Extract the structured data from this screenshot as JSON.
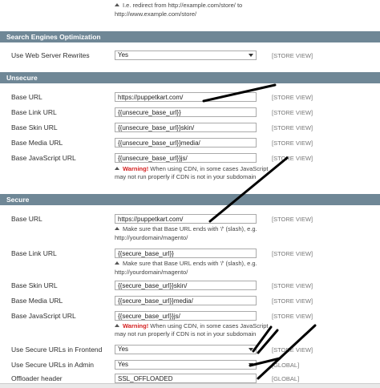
{
  "top_note": {
    "line1": "I.e. redirect from http://example.com/store/ to",
    "line2": "http://www.example.com/store/"
  },
  "seo": {
    "title": "Search Engines Optimization",
    "rewrites_label": "Use Web Server Rewrites",
    "rewrites_value": "Yes",
    "rewrites_scope": "[STORE VIEW]"
  },
  "unsecure": {
    "title": "Unsecure",
    "base_url_label": "Base URL",
    "base_url_value": "https://puppetkart.com/",
    "base_url_scope": "[STORE VIEW]",
    "base_link_label": "Base Link URL",
    "base_link_value": "{{unsecure_base_url}}",
    "base_link_scope": "[STORE VIEW]",
    "base_skin_label": "Base Skin URL",
    "base_skin_value": "{{unsecure_base_url}}skin/",
    "base_skin_scope": "[STORE VIEW]",
    "base_media_label": "Base Media URL",
    "base_media_value": "{{unsecure_base_url}}media/",
    "base_media_scope": "[STORE VIEW]",
    "base_js_label": "Base JavaScript URL",
    "base_js_value": "{{unsecure_base_url}}js/",
    "base_js_scope": "[STORE VIEW]",
    "warning_word": "Warning!",
    "warning_line1": " When using CDN, in some cases JavaScript",
    "warning_line2": "may not run properly if CDN is not in your subdomain"
  },
  "secure": {
    "title": "Secure",
    "base_url_label": "Base URL",
    "base_url_value": "https://puppetkart.com/",
    "base_url_scope": "[STORE VIEW]",
    "base_url_note1": "Make sure that Base URL ends with '/' (slash), e.g.",
    "base_url_note2": "http://yourdomain/magento/",
    "base_link_label": "Base Link URL",
    "base_link_value": "{{secure_base_url}}",
    "base_link_scope": "[STORE VIEW]",
    "base_link_note1": "Make sure that Base URL ends with '/' (slash), e.g.",
    "base_link_note2": "http://yourdomain/magento/",
    "base_skin_label": "Base Skin URL",
    "base_skin_value": "{{secure_base_url}}skin/",
    "base_skin_scope": "[STORE VIEW]",
    "base_media_label": "Base Media URL",
    "base_media_value": "{{secure_base_url}}media/",
    "base_media_scope": "[STORE VIEW]",
    "base_js_label": "Base JavaScript URL",
    "base_js_value": "{{secure_base_url}}js/",
    "base_js_scope": "[STORE VIEW]",
    "warning_word": "Warning!",
    "warning_line1": " When using CDN, in some cases JavaScript",
    "warning_line2": "may not run properly if CDN is not in your subdomain",
    "frontend_label": "Use Secure URLs in Frontend",
    "frontend_value": "Yes",
    "frontend_scope": "[STORE VIEW]",
    "admin_label": "Use Secure URLs in Admin",
    "admin_value": "Yes",
    "admin_scope": "[GLOBAL]",
    "offloader_label": "Offloader header",
    "offloader_value": "SSL_OFFLOADED",
    "offloader_scope": "[GLOBAL]"
  },
  "colors": {
    "section_header": "#6f8796",
    "warning": "#d42020",
    "annotation_stroke": "#000000"
  }
}
